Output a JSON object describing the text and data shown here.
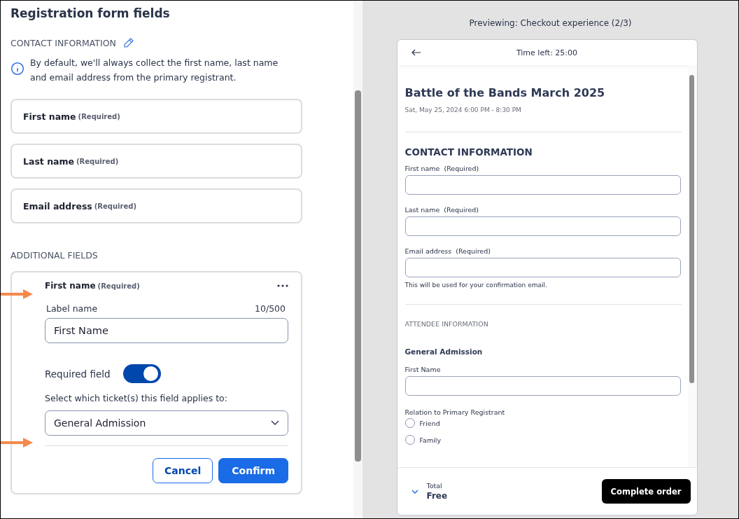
{
  "editor": {
    "title": "Registration form fields",
    "contact_section": {
      "heading": "CONTACT INFORMATION",
      "info": "By default, we'll always collect the first name, last name and email address from the primary registrant.",
      "fields": [
        {
          "label": "First name",
          "note": "(Required)"
        },
        {
          "label": "Last name",
          "note": "(Required)"
        },
        {
          "label": "Email address",
          "note": "(Required)"
        }
      ]
    },
    "additional_section": {
      "heading": "ADDITIONAL FIELDS",
      "field": {
        "label": "First name",
        "note": "(Required)",
        "label_caption": "Label name",
        "counter": "10/500",
        "label_value": "First Name",
        "toggle_label": "Required field",
        "required_on": true,
        "ticket_prompt": "Select which ticket(s) this field applies to:",
        "ticket_value": "General Admission",
        "cancel": "Cancel",
        "confirm": "Confirm"
      }
    }
  },
  "preview": {
    "caption": "Previewing: Checkout experience (2/3)",
    "time_left": "Time left: 25:00",
    "event_title": "Battle of the Bands March 2025",
    "event_date": "Sat, May 25, 2024 6:00 PM - 8:30 PM",
    "contact_heading": "CONTACT INFORMATION",
    "contact_fields": [
      {
        "label": "First name  (Required)"
      },
      {
        "label": "Last name  (Required)"
      },
      {
        "label": "Email address  (Required)",
        "hint": "This will be used for your confirmation email."
      }
    ],
    "attendee_heading": "ATTENDEE INFORMATION",
    "ticket_name": "General Admission",
    "attendee_fields": [
      {
        "label": "First Name"
      }
    ],
    "radio_group": {
      "label": "Relation to Primary Registrant",
      "options": [
        {
          "label": "Friend",
          "selected": false
        },
        {
          "label": "Family",
          "selected": false
        }
      ]
    },
    "total_label": "Total",
    "total_value": "Free",
    "complete_button": "Complete order"
  }
}
